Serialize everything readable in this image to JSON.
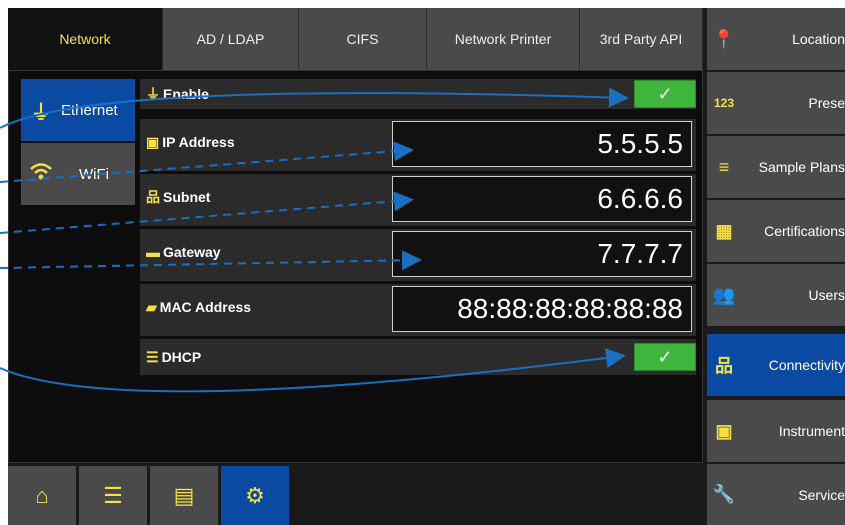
{
  "tabs": [
    {
      "label": "Network",
      "active": true
    },
    {
      "label": "AD / LDAP"
    },
    {
      "label": "CIFS"
    },
    {
      "label": "Network Printer"
    },
    {
      "label": "3rd Party API"
    }
  ],
  "side_nav": {
    "ethernet": "Ethernet",
    "wifi": "WiFi"
  },
  "fields": {
    "enable": {
      "label": "Enable",
      "checked": true
    },
    "ip": {
      "label": "IP Address",
      "value": "5.5.5.5"
    },
    "subnet": {
      "label": "Subnet",
      "value": "6.6.6.6"
    },
    "gateway": {
      "label": "Gateway",
      "value": "7.7.7.7"
    },
    "mac": {
      "label": "MAC Address",
      "value": "88:88:88:88:88:88"
    },
    "dhcp": {
      "label": "DHCP",
      "checked": true
    }
  },
  "right_menu": {
    "location": "Location",
    "presets": "Prese",
    "sample_plans": "Sample Plans",
    "certifications": "Certifications",
    "users": "Users",
    "connectivity": "Connectivity",
    "instrument": "Instrument",
    "service": "Service"
  },
  "icons": {
    "check": "✓",
    "presets_glyph": "123"
  },
  "colors": {
    "accent_yellow": "#f6e043",
    "active_blue": "#0b4aa3",
    "check_green": "#3fb53d",
    "annotation_arrow": "#1a6fc0"
  }
}
